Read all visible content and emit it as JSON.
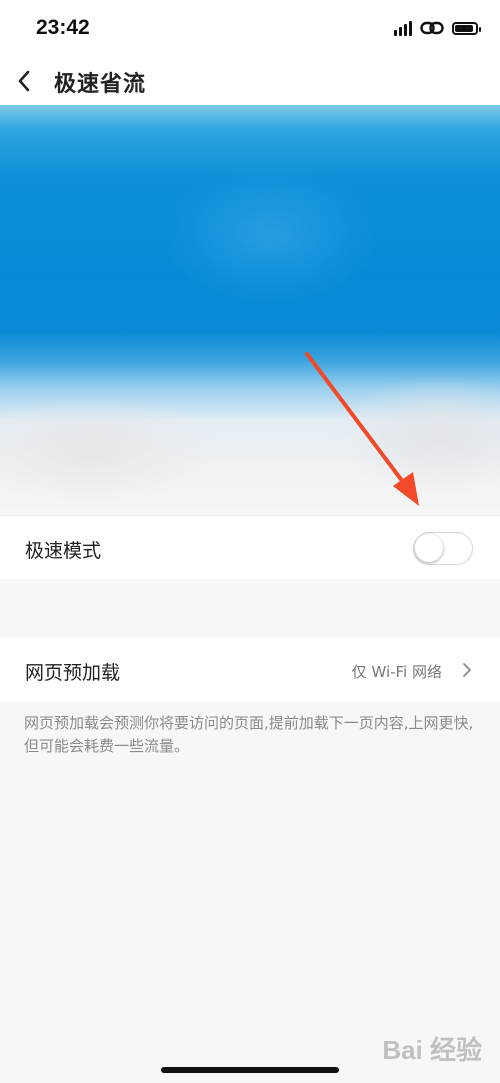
{
  "status": {
    "time": "23:42",
    "icons": [
      "signal-icon",
      "link-icon",
      "battery-icon"
    ]
  },
  "nav": {
    "title": "极速省流",
    "back_icon": "chevron-left-icon"
  },
  "settings": {
    "speed_mode": {
      "label": "极速模式",
      "enabled": false
    },
    "preload": {
      "label": "网页预加载",
      "value": "仅 Wi-Fi 网络"
    },
    "preload_description": "网页预加载会预测你将要访问的页面,提前加载下一页内容,上网更快,但可能会耗费一些流量。"
  },
  "annotation": {
    "arrow_color": "#f04a2a"
  },
  "watermark": {
    "text": "Bai 经验"
  },
  "colors": {
    "banner_blue": "#078ad6",
    "background": "#f7f7f7"
  }
}
